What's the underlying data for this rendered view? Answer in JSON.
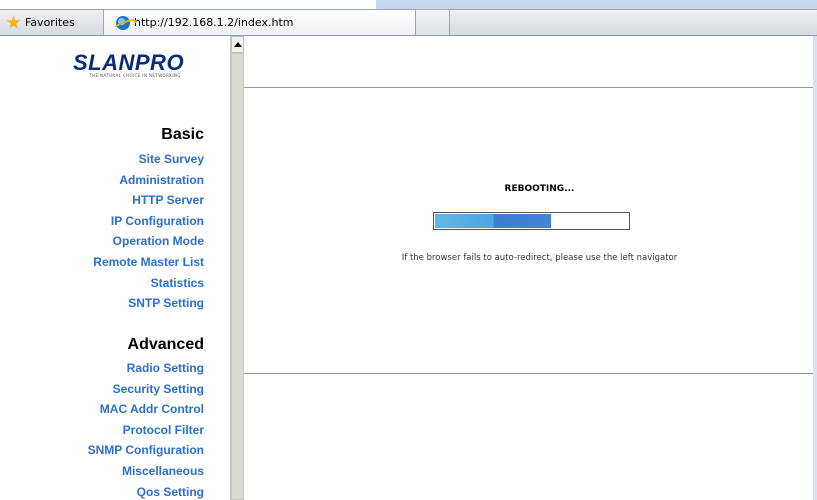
{
  "browser": {
    "favorites_label": "Favorites",
    "tab_title": "http://192.168.1.2/index.htm"
  },
  "logo": {
    "name": "SLANPRO",
    "tagline": "THE NATURAL CHOICE IN NETWORKING"
  },
  "nav": {
    "basic": {
      "heading": "Basic",
      "items": [
        "Site Survey",
        "Administration",
        "HTTP Server",
        "IP Configuration",
        "Operation Mode",
        "Remote Master List",
        "Statistics",
        "SNTP Setting"
      ]
    },
    "advanced": {
      "heading": "Advanced",
      "items": [
        "Radio Setting",
        "Security Setting",
        "MAC Addr Control",
        "Protocol Filter",
        "SNMP Configuration",
        "Miscellaneous",
        "Qos Setting"
      ]
    }
  },
  "main": {
    "status_title": "REBOOTING...",
    "progress_fraction": 0.6,
    "redirect_note": "If the browser fails to auto-redirect, please use the left navigator"
  }
}
